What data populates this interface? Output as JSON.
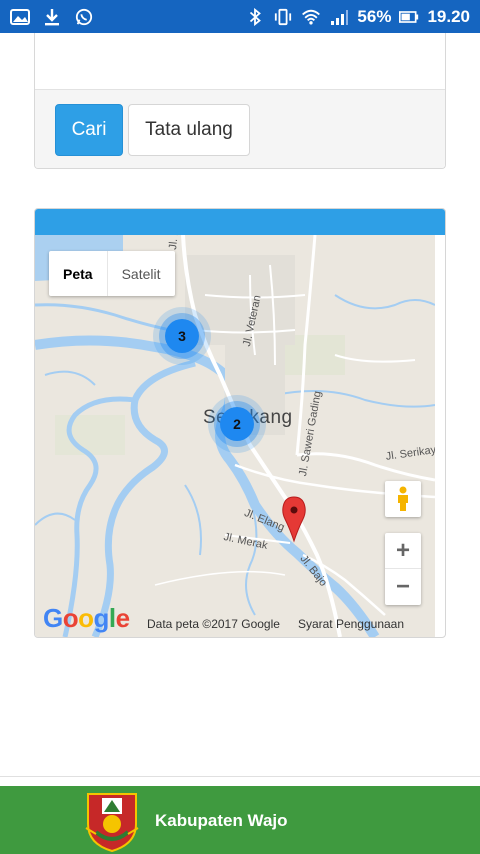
{
  "status_bar": {
    "battery": "56%",
    "time": "19.20",
    "icons": [
      "gallery-icon",
      "download-icon",
      "whatsapp-icon",
      "bluetooth-icon",
      "vibrate-icon",
      "wifi-icon",
      "signal-icon",
      "battery-icon"
    ]
  },
  "form": {
    "search_button": "Cari",
    "reset_button": "Tata ulang"
  },
  "map": {
    "type_controls": {
      "map": "Peta",
      "satellite": "Satelit"
    },
    "clusters": [
      {
        "count": "3"
      },
      {
        "count": "2"
      }
    ],
    "city_label": "Sengkang",
    "roads": {
      "veteran": "Jl. Veteran",
      "poros": "Jl. Po",
      "saweri": "Jl. Saweri Gading",
      "serikaya": "Jl. Serikay",
      "elang": "Jl. Elang",
      "merak": "Jl. Merak",
      "bajo": "Jl. Bajo"
    },
    "zoom_in": "+",
    "zoom_out": "−",
    "logo": "Google",
    "attribution": "Data peta ©2017 Google",
    "terms": "Syarat Penggunaan",
    "colors": {
      "water": "#a4cdf2",
      "road": "#ffffff",
      "land": "#ebe7df",
      "marker": "#e53935",
      "cluster": "#1e88f0"
    }
  },
  "footer": {
    "title": "Kabupaten Wajo",
    "background": "#3f9a3f"
  }
}
